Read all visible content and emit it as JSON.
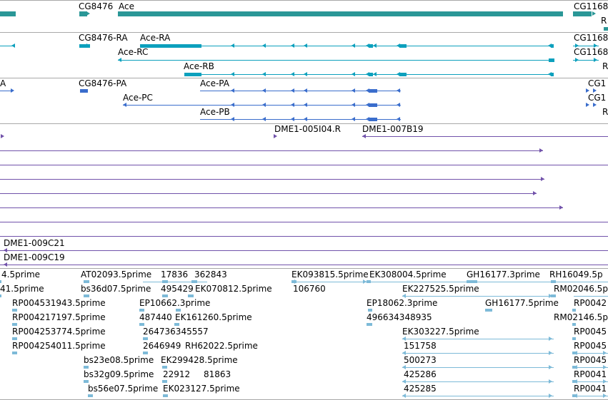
{
  "colors": {
    "gene": "#2a9797",
    "transcript": "#0ca0bd",
    "protein": "#3a6dcc",
    "clone": "#7152aa",
    "est": "#7dbad8",
    "border": "#a8a8a8"
  },
  "tracks": {
    "genes": {
      "labels": [
        "CG8476",
        "Ace",
        "CG1168",
        "R"
      ]
    },
    "transcripts": {
      "labels": [
        "CG8476-RA",
        "Ace-RA",
        "CG1168",
        "Ace-RC",
        "CG1168",
        "Ace-RB",
        "R"
      ]
    },
    "proteins": {
      "labels": [
        "A",
        "CG8476-PA",
        "Ace-PA",
        "CG1",
        "Ace-PC",
        "CG1",
        "Ace-PB",
        "R"
      ]
    },
    "clones": {
      "labels": [
        "DME1-005I04.R",
        "DME1-007B19",
        "DME1-009C21",
        "DME1-009C19"
      ]
    },
    "ests": {
      "labels": [
        "4.5prime",
        "AT02093.5prime",
        "17836",
        "362843",
        "EK093815.5prime",
        "EK308004.5prime",
        "GH16177.3prime",
        "RH16049.5p",
        "41.5prime",
        "bs36d07.5prime",
        "495429",
        "EK070812.5prime",
        "106760",
        "EK227525.5prime",
        "RM02046.5p",
        "RP004531943.5prime",
        "EP10662.3prime",
        "EP18062.3prime",
        "GH16177.5prime",
        "RP0042",
        "RP004217197.5prime",
        "487440",
        "EK161260.5prime",
        "496634348935",
        "RM02146.5p",
        "RP004253774.5prime",
        "264736345557",
        "EK303227.5prime",
        "RP0045",
        "RP004254011.5prime",
        "2646949",
        "RH62022.5prime",
        "151758",
        "RP0045",
        "bs23e08.5prime",
        "EK299428.5prime",
        "500273",
        "RP0045",
        "bs32g09.5prime",
        "22912",
        "81863",
        "425286",
        "RP0041",
        "bs56e07.5prime",
        "EK023127.5prime",
        "425285",
        "RP0041"
      ]
    }
  }
}
